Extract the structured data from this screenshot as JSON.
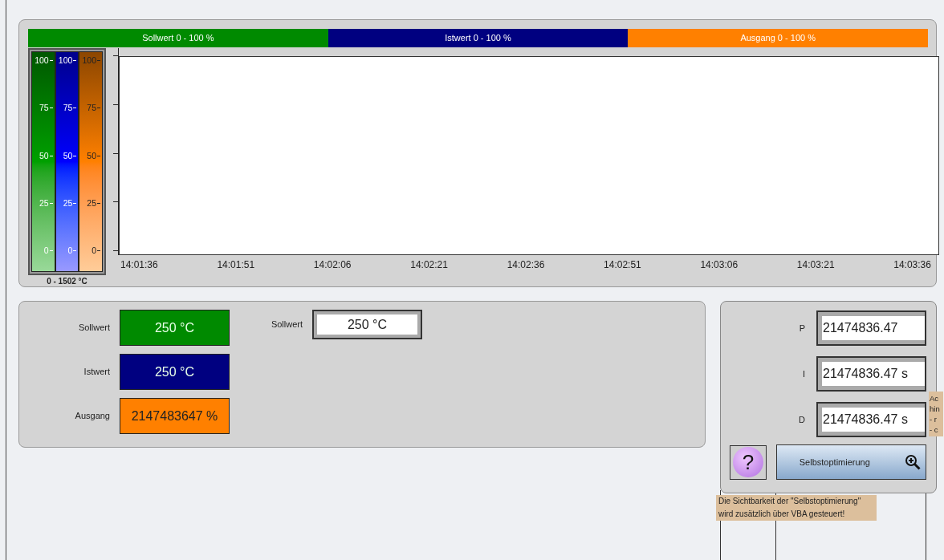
{
  "trend": {
    "legend": [
      {
        "label": "Sollwert 0 - 100 %",
        "color": "#008a00"
      },
      {
        "label": "Istwert 0 - 100 %",
        "color": "#000080"
      },
      {
        "label": "Ausgang 0 - 100 %",
        "color": "#ff8000"
      }
    ],
    "scales": [
      {
        "color": "#00a000",
        "ticks": [
          "100",
          "75",
          "50",
          "25",
          "0"
        ]
      },
      {
        "color": "#0000ff",
        "ticks": [
          "100",
          "75",
          "50",
          "25",
          "0"
        ]
      },
      {
        "color": "#ff8000",
        "ticks": [
          "100",
          "75",
          "50",
          "25",
          "0"
        ]
      }
    ],
    "scale_caption": "0 - 1502 °C",
    "time_labels": [
      "14:01:36",
      "14:01:51",
      "14:02:06",
      "14:02:21",
      "14:02:36",
      "14:02:51",
      "14:03:06",
      "14:03:21",
      "14:03:36"
    ]
  },
  "values": [
    {
      "label": "Sollwert",
      "value": "250  °C",
      "color": "#008a00"
    },
    {
      "label": "Istwert",
      "value": "250  °C",
      "color": "#000080"
    },
    {
      "label": "Ausgang",
      "value": "2147483647  %",
      "color": "#ff8000"
    }
  ],
  "setpoint_input": {
    "label": "Sollwert",
    "value": "250  °C"
  },
  "pid": [
    {
      "label": "P",
      "value": "21474836.47"
    },
    {
      "label": "I",
      "value": "21474836.47  s"
    },
    {
      "label": "D",
      "value": "21474836.47  s"
    }
  ],
  "help_button": "?",
  "optimize_button": "Selbstoptimierung",
  "note": "Die Sichtbarkeit der \"Selbstoptimierung\" wird zusätzlich über VBA gesteuert!",
  "tooltip_lines": [
    "Ac",
    "hin",
    "- r",
    "- c"
  ]
}
